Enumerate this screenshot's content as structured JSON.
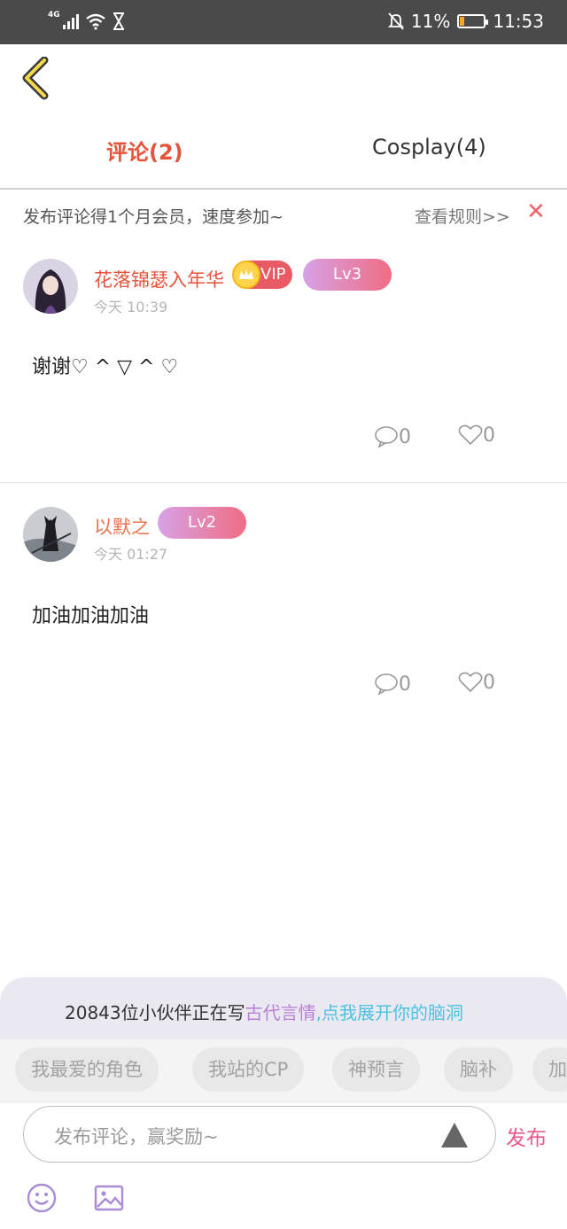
{
  "status_bar": {
    "network": "4G",
    "battery": "11%",
    "time": "11:53",
    "icons": [
      "signal-icon",
      "wifi-icon",
      "hourglass-icon",
      "mute-bell-icon",
      "battery-icon"
    ]
  },
  "tabs": [
    {
      "label": "评论(2)",
      "active": true
    },
    {
      "label": "Cosplay(4)",
      "active": false
    }
  ],
  "promo": {
    "text": "发布评论得1个月会员，速度参加~",
    "link": "查看规则>>",
    "close": "✕"
  },
  "comments": [
    {
      "username": "花落锦瑟入年华",
      "vip": "VIP",
      "level": "Lv3",
      "time": "今天 10:39",
      "text": "谢谢♡ ^ ▽ ^ ♡",
      "replies": "0",
      "likes": "0"
    },
    {
      "username": "以默之",
      "level": "Lv2",
      "time": "今天 01:27",
      "text": "加油加油加油",
      "replies": "0",
      "likes": "0"
    }
  ],
  "banner": {
    "prefix": "20843位小伙伴正在写",
    "genre": "古代言情",
    "cta": ",点我展开你的脑洞"
  },
  "chips": [
    "我最爱的角色",
    "我站的CP",
    "神预言",
    "脑补",
    "加"
  ],
  "input": {
    "placeholder": "发布评论，赢奖励~",
    "publish": "发布"
  },
  "colors": {
    "accent_red": "#e5533b",
    "username_orange": "#e8724a",
    "publish_pink": "#e85a8d",
    "level_gradient_start": "#d7a2e6",
    "level_gradient_end": "#f06d83"
  }
}
